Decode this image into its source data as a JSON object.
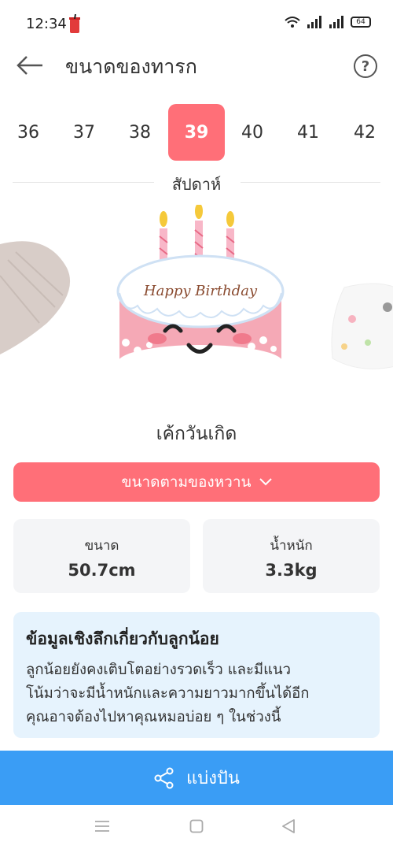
{
  "status": {
    "time": "12:34",
    "battery": "64"
  },
  "header": {
    "title": "ขนาดของทารก"
  },
  "weeks": {
    "items": [
      "36",
      "37",
      "38",
      "39",
      "40",
      "41",
      "42"
    ],
    "selected": "39",
    "label": "สัปดาห์"
  },
  "illustration": {
    "cake_text": "Happy Birthday",
    "caption": "เค้กวันเกิด"
  },
  "compare_button": {
    "label": "ขนาดตามของหวาน"
  },
  "stats": {
    "size": {
      "label": "ขนาด",
      "value": "50.7cm"
    },
    "weight": {
      "label": "น้ำหนัก",
      "value": "3.3kg"
    }
  },
  "insight": {
    "title": "ข้อมูลเชิงลึกเกี่ยวกับลูกน้อย",
    "lines": [
      "ลูกน้อยยังคงเติบโตอย่างรวดเร็ว และมีแนว",
      "โน้มว่าจะมีน้ำหนักและความยาวมากขึ้นได้อีก",
      "คุณอาจต้องไปหาคุณหมอบ่อย ๆ ในช่วงนี้"
    ]
  },
  "share": {
    "label": "แบ่งปัน"
  },
  "colors": {
    "accent": "#ff6f78",
    "share": "#3a9df5",
    "insight_bg": "#e6f3fd"
  }
}
